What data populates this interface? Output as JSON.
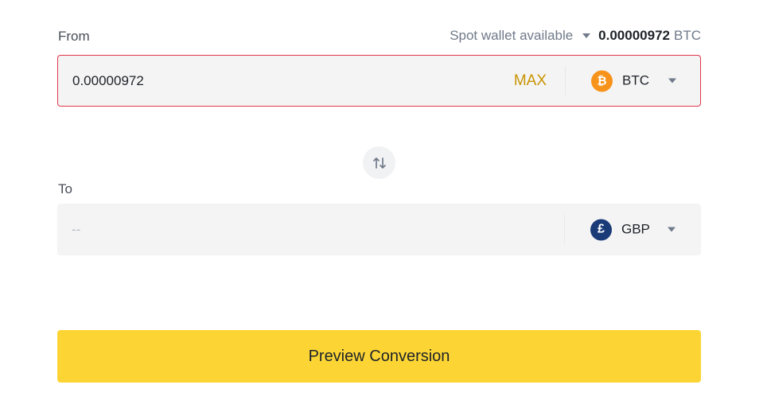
{
  "from": {
    "label": "From",
    "wallet_label": "Spot wallet available",
    "wallet_amount": "0.00000972",
    "wallet_unit": "BTC",
    "amount_value": "0.00000972",
    "max_label": "MAX",
    "coin_symbol": "BTC",
    "coin_icon": "bitcoin-icon",
    "coin_glyph": "₿",
    "coin_color": "#f7931a",
    "border_color": "#e0354c"
  },
  "to": {
    "label": "To",
    "amount_placeholder": "--",
    "coin_symbol": "GBP",
    "coin_icon": "pound-icon",
    "coin_glyph": "£",
    "coin_color": "#1b3a78"
  },
  "swap": {
    "icon": "swap-arrows-icon"
  },
  "preview_button": {
    "label": "Preview Conversion",
    "color": "#fcd535"
  },
  "colors": {
    "accent_text": "#c99400",
    "field_bg": "#f4f4f4"
  }
}
